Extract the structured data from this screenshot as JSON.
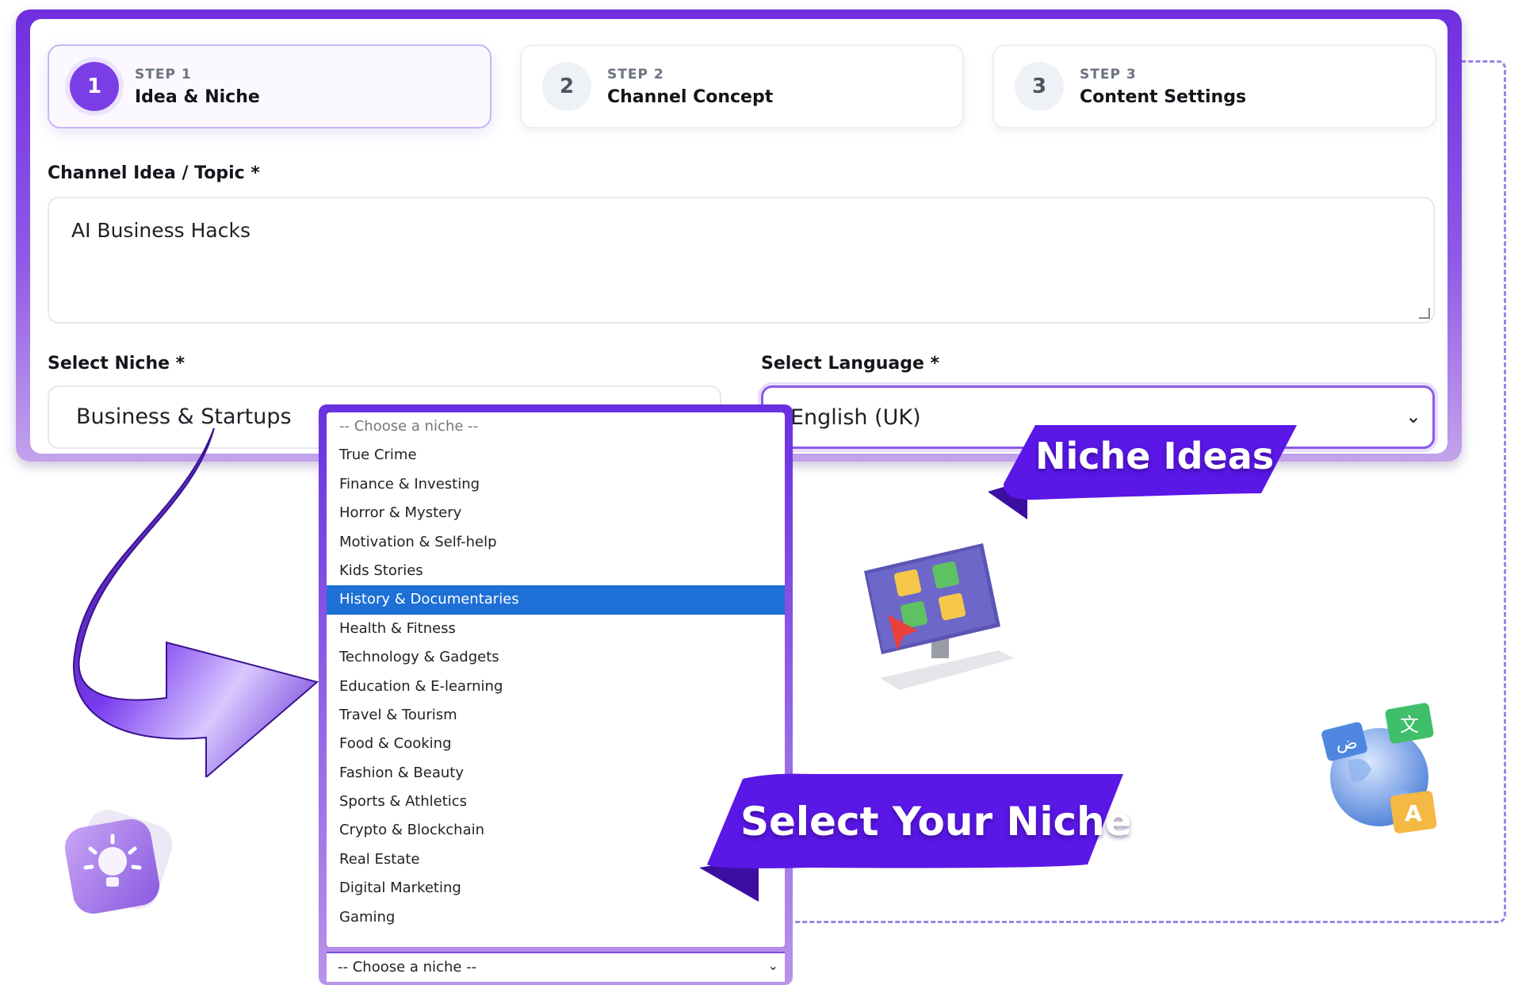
{
  "steps": [
    {
      "number": "1",
      "kicker": "STEP 1",
      "title": "Idea & Niche",
      "active": true
    },
    {
      "number": "2",
      "kicker": "STEP 2",
      "title": "Channel Concept",
      "active": false
    },
    {
      "number": "3",
      "kicker": "STEP 3",
      "title": "Content Settings",
      "active": false
    }
  ],
  "topic": {
    "label": "Channel Idea / Topic *",
    "value": "AI Business Hacks"
  },
  "niche": {
    "label": "Select Niche *",
    "value": "Business & Startups"
  },
  "language": {
    "label": "Select Language *",
    "value": "English (UK)"
  },
  "dropdown": {
    "placeholder": "-- Choose a niche --",
    "options": [
      "True Crime",
      "Finance & Investing",
      "Horror & Mystery",
      "Motivation & Self-help",
      "Kids Stories",
      "History & Documentaries",
      "Health & Fitness",
      "Technology & Gadgets",
      "Education & E-learning",
      "Travel & Tourism",
      "Food & Cooking",
      "Fashion & Beauty",
      "Sports & Athletics",
      "Crypto & Blockchain",
      "Real Estate",
      "Digital Marketing",
      "Gaming"
    ],
    "highlighted": "History & Documentaries",
    "footer_value": "-- Choose a niche --"
  },
  "ribbons": {
    "niche_ideas": "Niche Ideas",
    "select_your_niche": "Select Your Niche"
  },
  "colors": {
    "accent": "#7b3ee6",
    "highlight": "#1e6fd6",
    "ribbon": "#5a17e6"
  },
  "icons": [
    "lightbulb-icon",
    "monitor-apps-icon",
    "globe-translate-icon",
    "curved-arrow"
  ]
}
